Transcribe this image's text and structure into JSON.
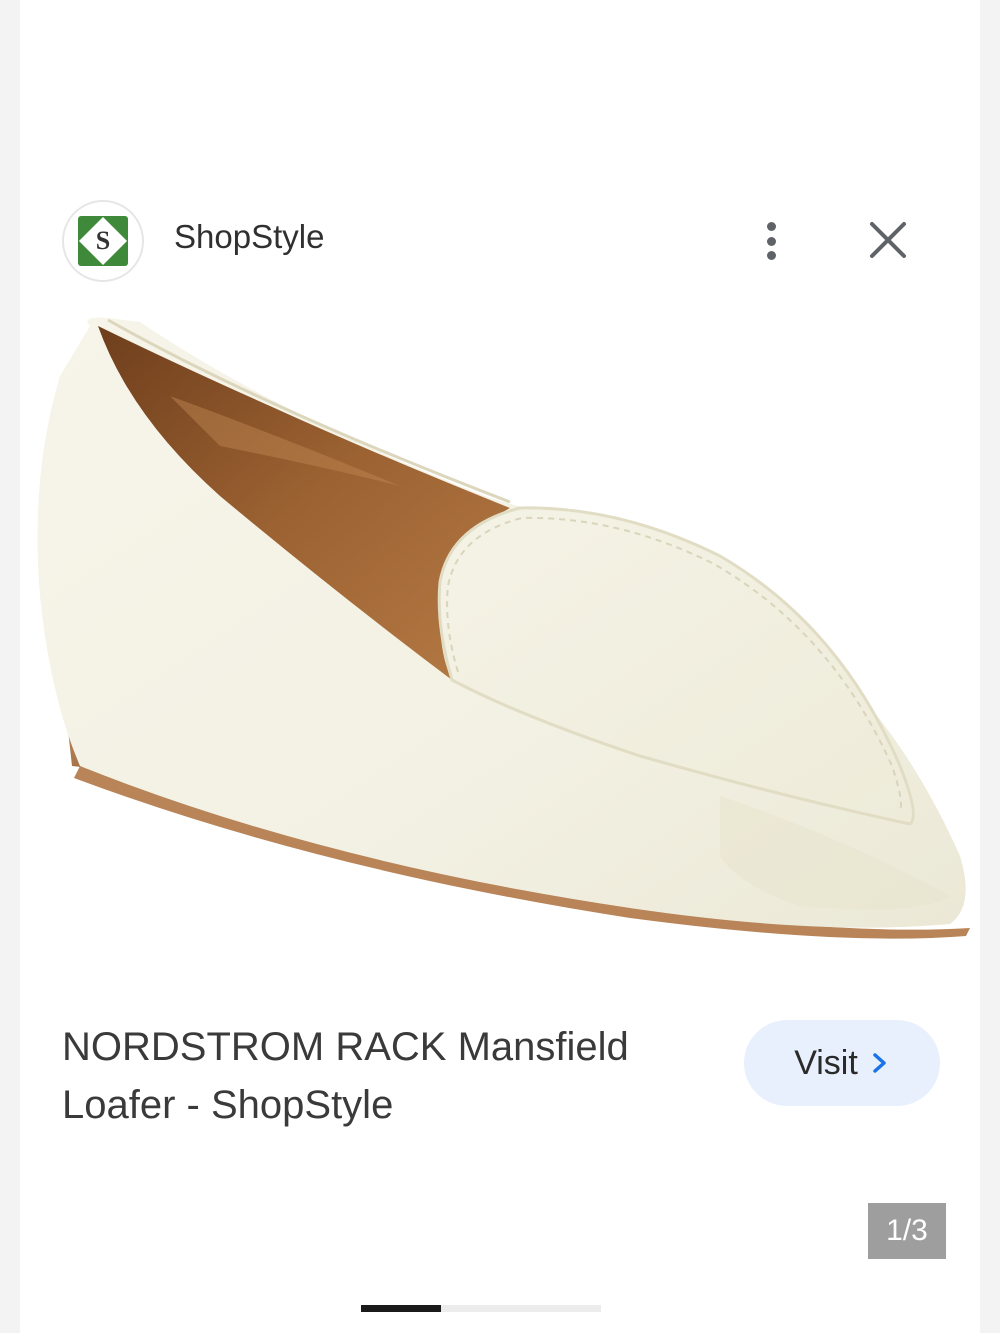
{
  "header": {
    "logo_letter": "S",
    "site_name": "ShopStyle",
    "more_icon": "more-vert-icon",
    "close_icon": "close-icon"
  },
  "product": {
    "image_subject": "white-pointed-loafer",
    "title": "NORDSTROM RACK Mansfield Loafer - ShopStyle"
  },
  "visit": {
    "label": "Visit",
    "icon": "chevron-right-icon",
    "accent_color": "#1a73e8"
  },
  "pager": {
    "counter": "1/3",
    "progress_fraction": 0.333
  },
  "colors": {
    "logo_green": "#3f8a3a",
    "visit_bg": "#e8f0fd"
  }
}
